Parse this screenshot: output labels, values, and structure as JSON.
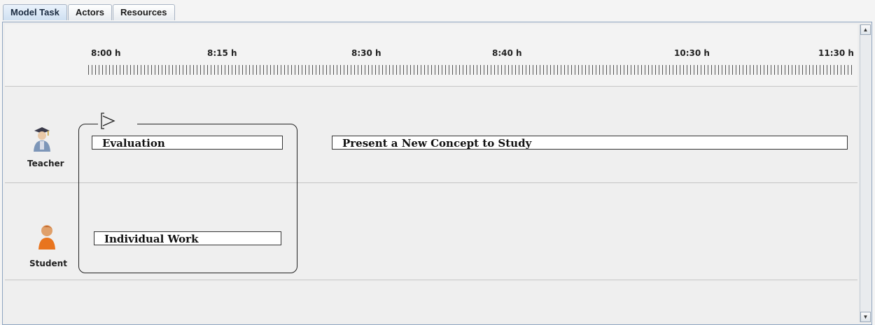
{
  "tabs": [
    {
      "label": "Model Task",
      "active": true
    },
    {
      "label": "Actors",
      "active": false
    },
    {
      "label": "Resources",
      "active": false
    }
  ],
  "timeline": {
    "labels": [
      "8:00 h",
      "8:15 h",
      "8:30 h",
      "8:40 h",
      "10:30 h",
      "11:30 h"
    ]
  },
  "actors": [
    {
      "name": "Teacher",
      "icon": "teacher-icon"
    },
    {
      "name": "Student",
      "icon": "student-icon"
    }
  ],
  "tasks": {
    "evaluation": "Evaluation",
    "present_concept": "Present a New Concept to Study",
    "individual_work": "Individual Work"
  },
  "scrollbar": {
    "up": "▲",
    "down": "▼"
  },
  "colors": {
    "tab_border": "#a8b4c4",
    "frame_border": "#8ea4c0",
    "student_orange": "#e8741e",
    "teacher_blue": "#7d96b8"
  }
}
